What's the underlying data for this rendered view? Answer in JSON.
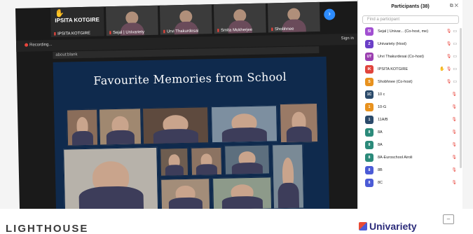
{
  "video_strip": {
    "main_tile_name": "IPSITA KOTGIRE",
    "main_tile_label": "IPSITA KOTGIRE",
    "tiles": [
      {
        "name": "Sejal | Univariety"
      },
      {
        "name": "Urvi Thakurdesai"
      },
      {
        "name": "Smita Mukherjee"
      },
      {
        "name": "Shobhnee"
      }
    ]
  },
  "top_bar": {
    "recording": "Recording...",
    "sign_in": "Sign in"
  },
  "address_bar": {
    "url": "about:blank"
  },
  "slide": {
    "title": "Favourite Memories from School"
  },
  "participants": {
    "title": "Participants (38)",
    "search_placeholder": "Find a participant",
    "list": [
      {
        "initials": "SI",
        "name": "Sejal | Univar... (Co-host, me)",
        "color": "#a14fd1"
      },
      {
        "initials": "Z",
        "name": "Univariety (Host)",
        "color": "#6b3fc7"
      },
      {
        "initials": "UT",
        "name": "Urvi Thakurdesai (Co-host)",
        "color": "#9b3fb0"
      },
      {
        "initials": "IK",
        "name": "IPSITA KOTGIRE",
        "color": "#e0443c"
      },
      {
        "initials": "S",
        "name": "Shobhnee (Co-host)",
        "color": "#e8921e"
      },
      {
        "initials": "1C",
        "name": "10 c",
        "color": "#2b4a6a"
      },
      {
        "initials": "1",
        "name": "10-G",
        "color": "#e8921e"
      },
      {
        "initials": "1",
        "name": "11A/B",
        "color": "#2b4a6a"
      },
      {
        "initials": "8",
        "name": "8A",
        "color": "#2b8a7a"
      },
      {
        "initials": "8",
        "name": "8A",
        "color": "#2b8a7a"
      },
      {
        "initials": "8",
        "name": "8A-Euroschool Airoli",
        "color": "#2b8a7a"
      },
      {
        "initials": "8",
        "name": "8B",
        "color": "#4b5bd6"
      },
      {
        "initials": "8",
        "name": "8C",
        "color": "#4b5bd6"
      }
    ]
  },
  "footer": {
    "left_logo": "LIGHTHOUSE",
    "right_logo": "Univariety"
  }
}
